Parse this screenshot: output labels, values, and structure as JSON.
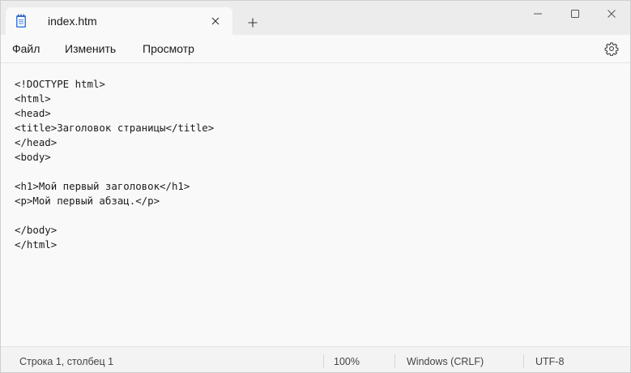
{
  "tab": {
    "title": "index.htm",
    "icon": "notepad-icon"
  },
  "window_controls": {
    "new_tab": "+",
    "minimize": "minimize-icon",
    "maximize": "maximize-icon",
    "close": "close-icon"
  },
  "menu": {
    "file": "Файл",
    "edit": "Изменить",
    "view": "Просмотр",
    "settings_icon": "gear-icon"
  },
  "editor": {
    "lines": [
      "<!DOCTYPE html>",
      "<html>",
      "<head>",
      "<title>Заголовок страницы</title>",
      "</head>",
      "<body>",
      "",
      "<h1>Мой первый заголовок</h1>",
      "<p>Мой первый абзац.</p>",
      "",
      "</body>",
      "</html>"
    ]
  },
  "status": {
    "position": "Строка 1, столбец 1",
    "zoom": "100%",
    "line_endings": "Windows (CRLF)",
    "encoding": "UTF-8"
  },
  "colors": {
    "accent": "#1f5fbf",
    "background": "#f9f9f9",
    "titlebar": "#ececec"
  }
}
